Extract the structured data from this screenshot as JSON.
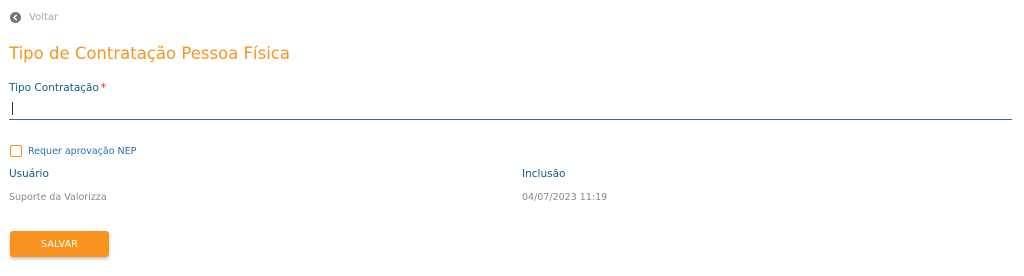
{
  "back": {
    "icon": "arrow-left-circle-icon",
    "label": "Voltar"
  },
  "page_title": "Tipo de Contratação Pessoa Física",
  "form": {
    "tipo_contratacao": {
      "label": "Tipo Contratação",
      "required_marker": "*",
      "value": ""
    },
    "requer_aprovacao": {
      "label": "Requer aprovação NEP",
      "checked": false
    }
  },
  "meta": {
    "usuario": {
      "header": "Usuário",
      "value": "Suporte da Valorizza"
    },
    "inclusao": {
      "header": "Inclusão",
      "value": "04/07/2023 11:19"
    }
  },
  "actions": {
    "save_label": "SALVAR"
  },
  "colors": {
    "accent": "#f7931e",
    "label_blue": "#1a5a8a",
    "required": "#e02020"
  }
}
